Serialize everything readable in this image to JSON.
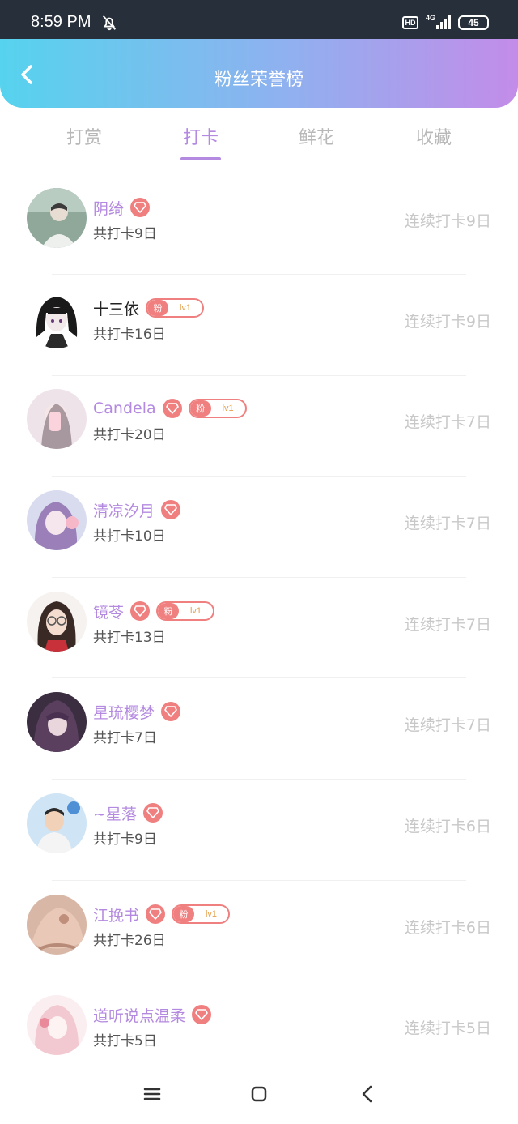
{
  "status": {
    "time": "8:59 PM",
    "hd": "HD",
    "network": "4G",
    "battery": "45"
  },
  "header": {
    "title": "粉丝荣誉榜"
  },
  "tabs": [
    {
      "label": "打赏",
      "active": false
    },
    {
      "label": "打卡",
      "active": true
    },
    {
      "label": "鲜花",
      "active": false
    },
    {
      "label": "收藏",
      "active": false
    }
  ],
  "fans": [
    {
      "name": "阴绮",
      "vip": true,
      "fan_badge": false,
      "total": "共打卡9日",
      "streak": "连续打卡9日"
    },
    {
      "name": "十三依",
      "vip": false,
      "fan_badge": true,
      "badge_label": "粉",
      "badge_level": "lv1",
      "total": "共打卡16日",
      "streak": "连续打卡9日"
    },
    {
      "name": "Candela",
      "vip": true,
      "fan_badge": true,
      "badge_label": "粉",
      "badge_level": "lv1",
      "total": "共打卡20日",
      "streak": "连续打卡7日"
    },
    {
      "name": "清凉汐月",
      "vip": true,
      "fan_badge": false,
      "total": "共打卡10日",
      "streak": "连续打卡7日"
    },
    {
      "name": "镜苓",
      "vip": true,
      "fan_badge": true,
      "badge_label": "粉",
      "badge_level": "lv1",
      "total": "共打卡13日",
      "streak": "连续打卡7日"
    },
    {
      "name": "星琉樱梦",
      "vip": true,
      "fan_badge": false,
      "total": "共打卡7日",
      "streak": "连续打卡7日"
    },
    {
      "name": "~星落",
      "vip": true,
      "fan_badge": false,
      "total": "共打卡9日",
      "streak": "连续打卡6日"
    },
    {
      "name": "江挽书",
      "vip": true,
      "fan_badge": true,
      "badge_label": "粉",
      "badge_level": "lv1",
      "total": "共打卡26日",
      "streak": "连续打卡6日"
    },
    {
      "name": "道听说点温柔",
      "vip": true,
      "fan_badge": false,
      "total": "共打卡5日",
      "streak": "连续打卡5日"
    }
  ],
  "colors": {
    "accent": "#b48ae0",
    "vip": "#f08080",
    "header_start": "#56d3ee",
    "header_end": "#c38ce8"
  }
}
